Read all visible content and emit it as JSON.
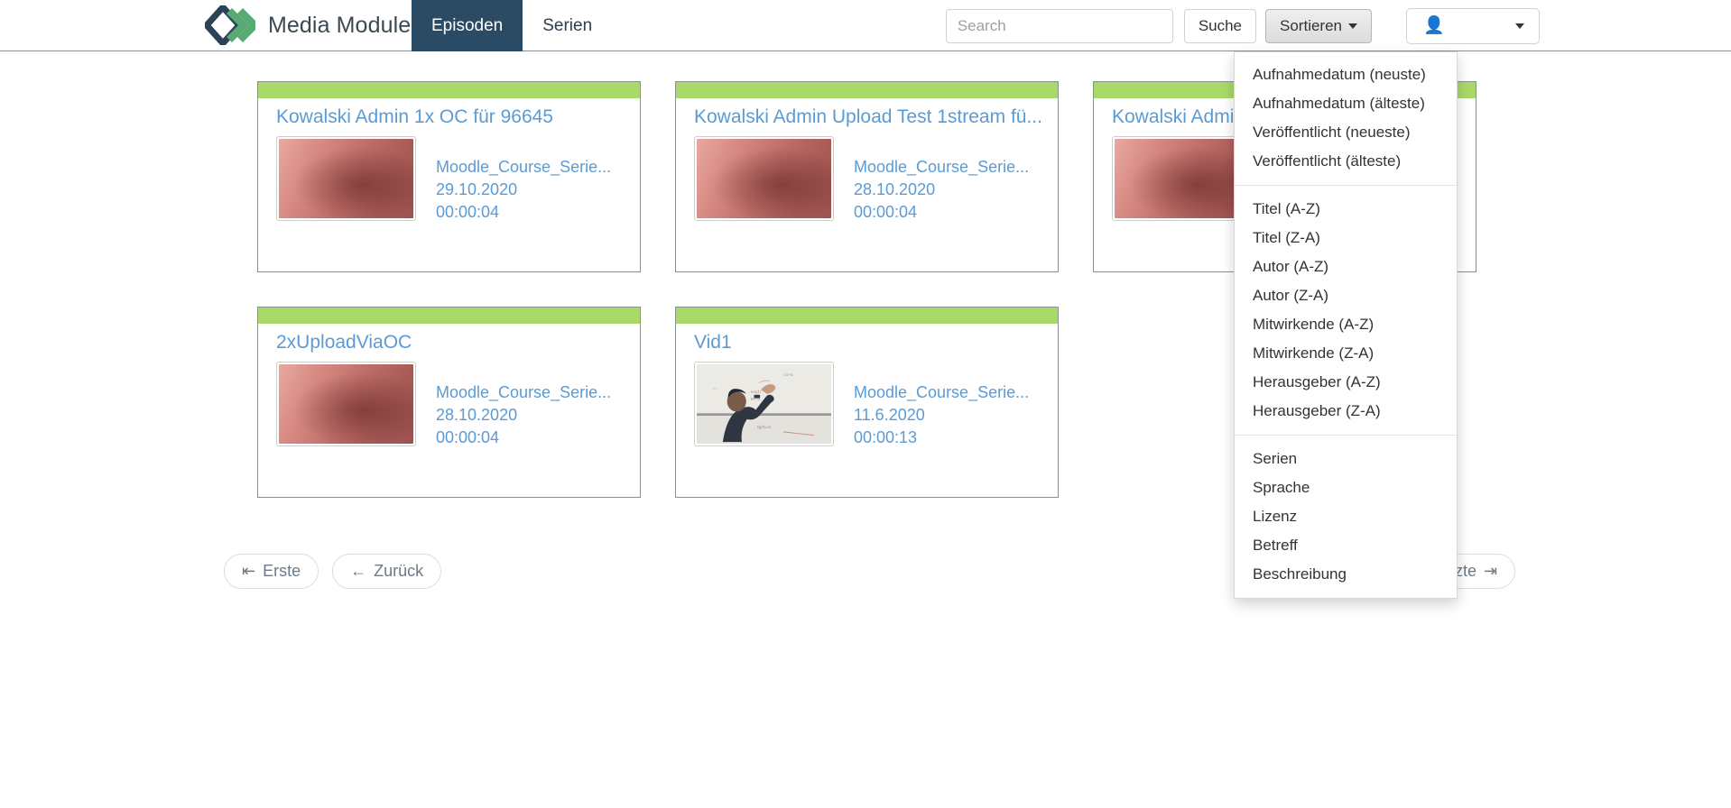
{
  "header": {
    "brand_title": "Media Module",
    "logo_icon": "diamond-chevrons-logo",
    "tabs": [
      {
        "label": "Episoden",
        "active": true
      },
      {
        "label": "Serien",
        "active": false
      }
    ],
    "search": {
      "value": "",
      "placeholder": "Search",
      "icon": "search-input"
    },
    "search_button": "Suche",
    "sort_button": "Sortieren",
    "user_icon": "user-avatar-icon",
    "user_caret_icon": "chevron-down-icon"
  },
  "sort_dropdown": {
    "open": true,
    "groups": [
      {
        "items": [
          "Aufnahmedatum (neuste)",
          "Aufnahmedatum (älteste)",
          "Veröffentlicht (neueste)",
          "Veröffentlicht (älteste)"
        ]
      },
      {
        "items": [
          "Titel (A-Z)",
          "Titel (Z-A)",
          "Autor (A-Z)",
          "Autor (Z-A)",
          "Mitwirkende (A-Z)",
          "Mitwirkende (Z-A)",
          "Herausgeber (A-Z)",
          "Herausgeber (Z-A)"
        ]
      },
      {
        "items": [
          "Serien",
          "Sprache",
          "Lizenz",
          "Betreff",
          "Beschreibung"
        ]
      }
    ]
  },
  "cards": [
    {
      "title": "Kowalski Admin 1x OC für 96645",
      "series": "Moodle_Course_Serie...",
      "date": "29.10.2020",
      "duration": "00:00:04",
      "thumb": "skin-closeup",
      "strip_color": "#a8d969"
    },
    {
      "title": "Kowalski Admin Upload Test 1stream fü...",
      "series": "Moodle_Course_Serie...",
      "date": "28.10.2020",
      "duration": "00:00:04",
      "thumb": "skin-closeup",
      "strip_color": "#a8d969"
    },
    {
      "title": "Kowalski Admin",
      "series": "",
      "date": "",
      "duration": "",
      "thumb": "skin-closeup",
      "strip_color": "#a8d969"
    },
    {
      "title": "2xUploadViaOC",
      "series": "Moodle_Course_Serie...",
      "date": "28.10.2020",
      "duration": "00:00:04",
      "thumb": "skin-closeup",
      "strip_color": "#a8d969"
    },
    {
      "title": "Vid1",
      "series": "Moodle_Course_Serie...",
      "date": "11.6.2020",
      "duration": "00:00:13",
      "thumb": "whiteboard-lecture",
      "strip_color": "#a8d969"
    }
  ],
  "pagination": {
    "first": {
      "label": "Erste",
      "icon": "first-arrow-icon",
      "glyph": "⇤"
    },
    "prev": {
      "label": "Zurück",
      "icon": "left-arrow-icon",
      "glyph": "←"
    },
    "last": {
      "label": "zte",
      "icon": "last-arrow-icon",
      "glyph": "⇥"
    }
  },
  "colors": {
    "accent_green": "#a8d969",
    "link_blue": "#5b9bd5",
    "navy": "#2b4a63"
  }
}
